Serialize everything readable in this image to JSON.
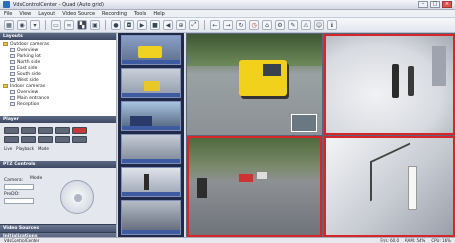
{
  "window": {
    "title": "VdsControlCenter - Quad (Auto grid)"
  },
  "menu": [
    "File",
    "View",
    "Layout",
    "Video Source",
    "Recording",
    "Tools",
    "Help"
  ],
  "layouts_panel": {
    "title": "Layouts",
    "items": [
      {
        "label": "Outdoor cameras",
        "folder": true,
        "depth": 0
      },
      {
        "label": "Overview",
        "folder": false,
        "depth": 1
      },
      {
        "label": "Parking lot",
        "folder": false,
        "depth": 1
      },
      {
        "label": "North side",
        "folder": false,
        "depth": 1
      },
      {
        "label": "East side",
        "folder": false,
        "depth": 1
      },
      {
        "label": "South side",
        "folder": false,
        "depth": 1
      },
      {
        "label": "West side",
        "folder": false,
        "depth": 1
      },
      {
        "label": "Indoor cameras",
        "folder": true,
        "depth": 0
      },
      {
        "label": "Overview",
        "folder": false,
        "depth": 1
      },
      {
        "label": "Main entrance",
        "folder": false,
        "depth": 1
      },
      {
        "label": "Reception",
        "folder": false,
        "depth": 1
      }
    ]
  },
  "player_panel": {
    "title": "Player",
    "modes": [
      "Live",
      "Playback",
      "Mode"
    ]
  },
  "ptz_panel": {
    "title": "PTZ Controls",
    "mode_label": "Mode",
    "camera_label": "Camera:",
    "preset_label": "PreDO:"
  },
  "bottom_panels": [
    "Video Sources",
    "Initializations"
  ],
  "statusbar": {
    "left": "VdsControlCenter",
    "right": [
      "Fr/s: 60.0",
      "RAM: 54%",
      "CPU: 16%"
    ]
  },
  "colors": {
    "accent_red": "#d7262a",
    "strip_bg": "#1f2a4a",
    "panel_head": "#3e4862"
  }
}
